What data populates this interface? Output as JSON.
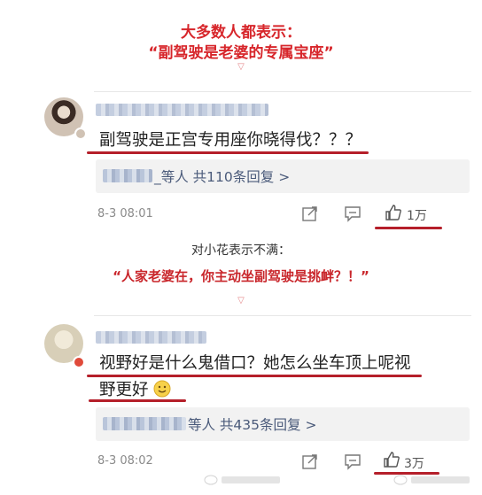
{
  "captions": {
    "top_line1": "大多数人都表示：",
    "top_line2": "“副驾驶是老婆的专属宝座”",
    "mid_plain": "对小花表示不满：",
    "mid_red": "“人家老婆在，你主动坐副驾驶是挑衅？！”"
  },
  "comments": [
    {
      "text": "副驾驶是正宫专用座你晓得伐？？？",
      "reply_summary": "_等人  共110条回复 >",
      "time": "8-3 08:01",
      "likes": "1万"
    },
    {
      "text_line1": "视野好是什么鬼借口？她怎么坐车顶上呢视",
      "text_line2": "野更好",
      "reply_summary": "等人  共435条回复 >",
      "time": "8-3 08:02",
      "likes": "3万"
    }
  ],
  "icons": {
    "share": "share-icon",
    "comment": "comment-icon",
    "like": "thumbs-up-icon",
    "emoji": "smiley-emoji-icon"
  },
  "colors": {
    "accent_red": "#d7262b",
    "underline": "#b51f2a",
    "reply_bg": "#f2f2f2",
    "reply_text": "#4a5a7a"
  }
}
